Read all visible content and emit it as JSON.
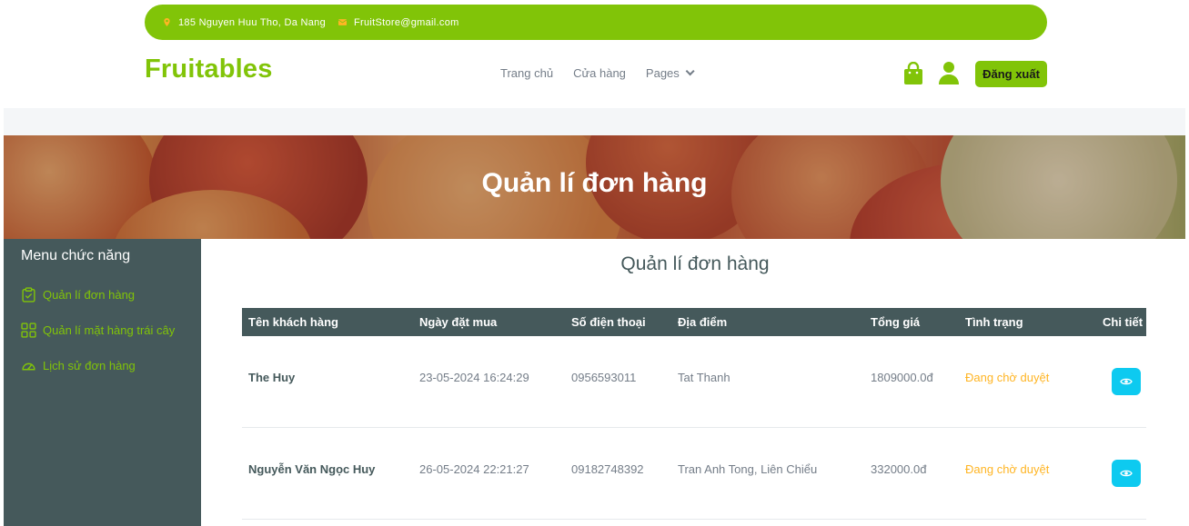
{
  "topbar": {
    "address": "185 Nguyen Huu Tho, Da Nang",
    "email": "FruitStore@gmail.com"
  },
  "header": {
    "brand": "Fruitables",
    "nav": [
      "Trang chủ",
      "Cửa hàng",
      "Pages"
    ],
    "logout": "Đăng xuất"
  },
  "hero": {
    "title": "Quản lí đơn hàng"
  },
  "sidebar": {
    "title": "Menu chức năng",
    "items": [
      "Quản lí đơn hàng",
      "Quản lí mặt hàng trái cây",
      "Lịch sử đơn hàng"
    ]
  },
  "main": {
    "title": "Quản lí đơn hàng",
    "columns": [
      "Tên khách hàng",
      "Ngày đặt mua",
      "Số điện thoại",
      "Địa điểm",
      "Tổng giá",
      "Tình trạng",
      "Chi tiết"
    ],
    "rows": [
      [
        "The Huy",
        "23-05-2024 16:24:29",
        "0956593011",
        "Tat Thanh",
        "1809000.0đ",
        "Đang chờ duyệt"
      ],
      [
        "Nguyễn Văn Ngọc Huy",
        "26-05-2024 22:21:27",
        "09182748392",
        "Tran Anh Tong, Liên Chiểu",
        "332000.0đ",
        "Đang chờ duyệt"
      ]
    ]
  },
  "colors": {
    "accent": "#81c408",
    "dark": "#45595b",
    "status": "#ffb524",
    "detail_button": "#0dcaf0"
  },
  "icons": [
    "location-icon",
    "mail-icon",
    "chevron-down-icon",
    "shopping-bag-icon",
    "user-icon",
    "clipboard-check-icon",
    "grid-icon",
    "speedometer-icon",
    "eye-icon"
  ]
}
